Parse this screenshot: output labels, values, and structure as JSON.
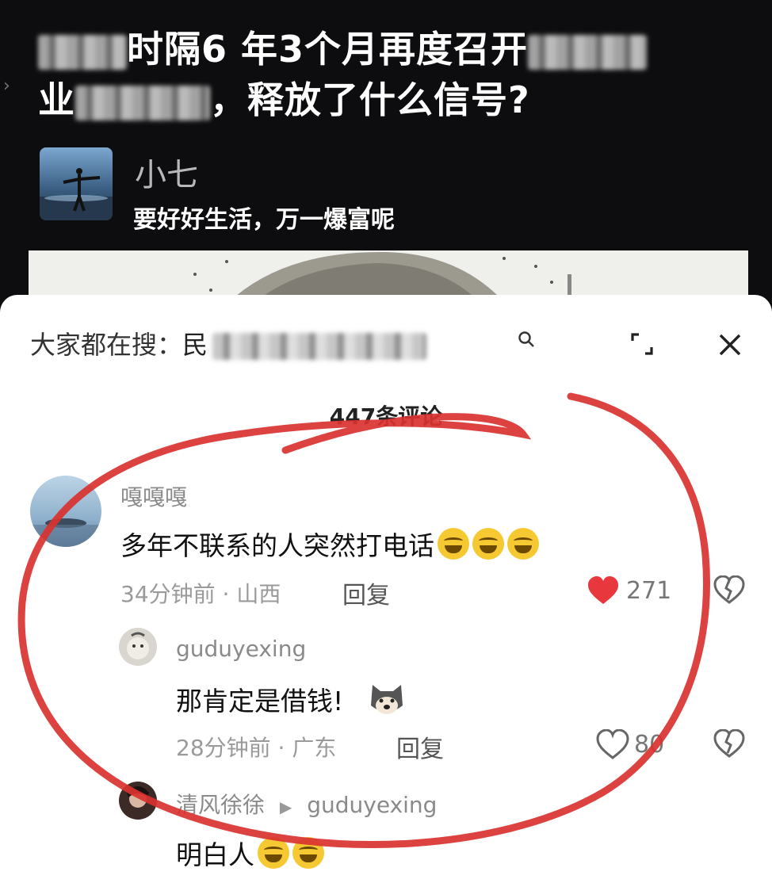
{
  "headline": {
    "part1": "时隔6 年3个月再度召开",
    "part2": "业",
    "part3": "，释放了什么信号?"
  },
  "author": {
    "name": "小七",
    "signature": "要好好生活，万一爆富呢"
  },
  "search": {
    "prefix": "大家都在搜：",
    "query_visible": "民"
  },
  "comments_header": {
    "count_text": "447条评论"
  },
  "comments": [
    {
      "username": "嘎嘎嘎",
      "text": "多年不联系的人突然打电话",
      "time_location": "34分钟前 · 山西",
      "reply_label": "回复",
      "likes": "271",
      "emoji": "laughing-crying-emoji"
    },
    {
      "username": "guduyexing",
      "text": "那肯定是借钱!",
      "time_location": "28分钟前 · 广东",
      "reply_label": "回复",
      "likes": "80",
      "emoji": "doge-emoji"
    },
    {
      "username": "清风徐徐",
      "reply_to": "guduyexing",
      "text": "明白人",
      "emoji": "laughing-crying-emoji"
    }
  ],
  "colors": {
    "like_active": "#e8383d",
    "annotation_stroke": "#d9322f",
    "sheet_background": "#ffffff",
    "video_background": "#0d0d0f"
  }
}
